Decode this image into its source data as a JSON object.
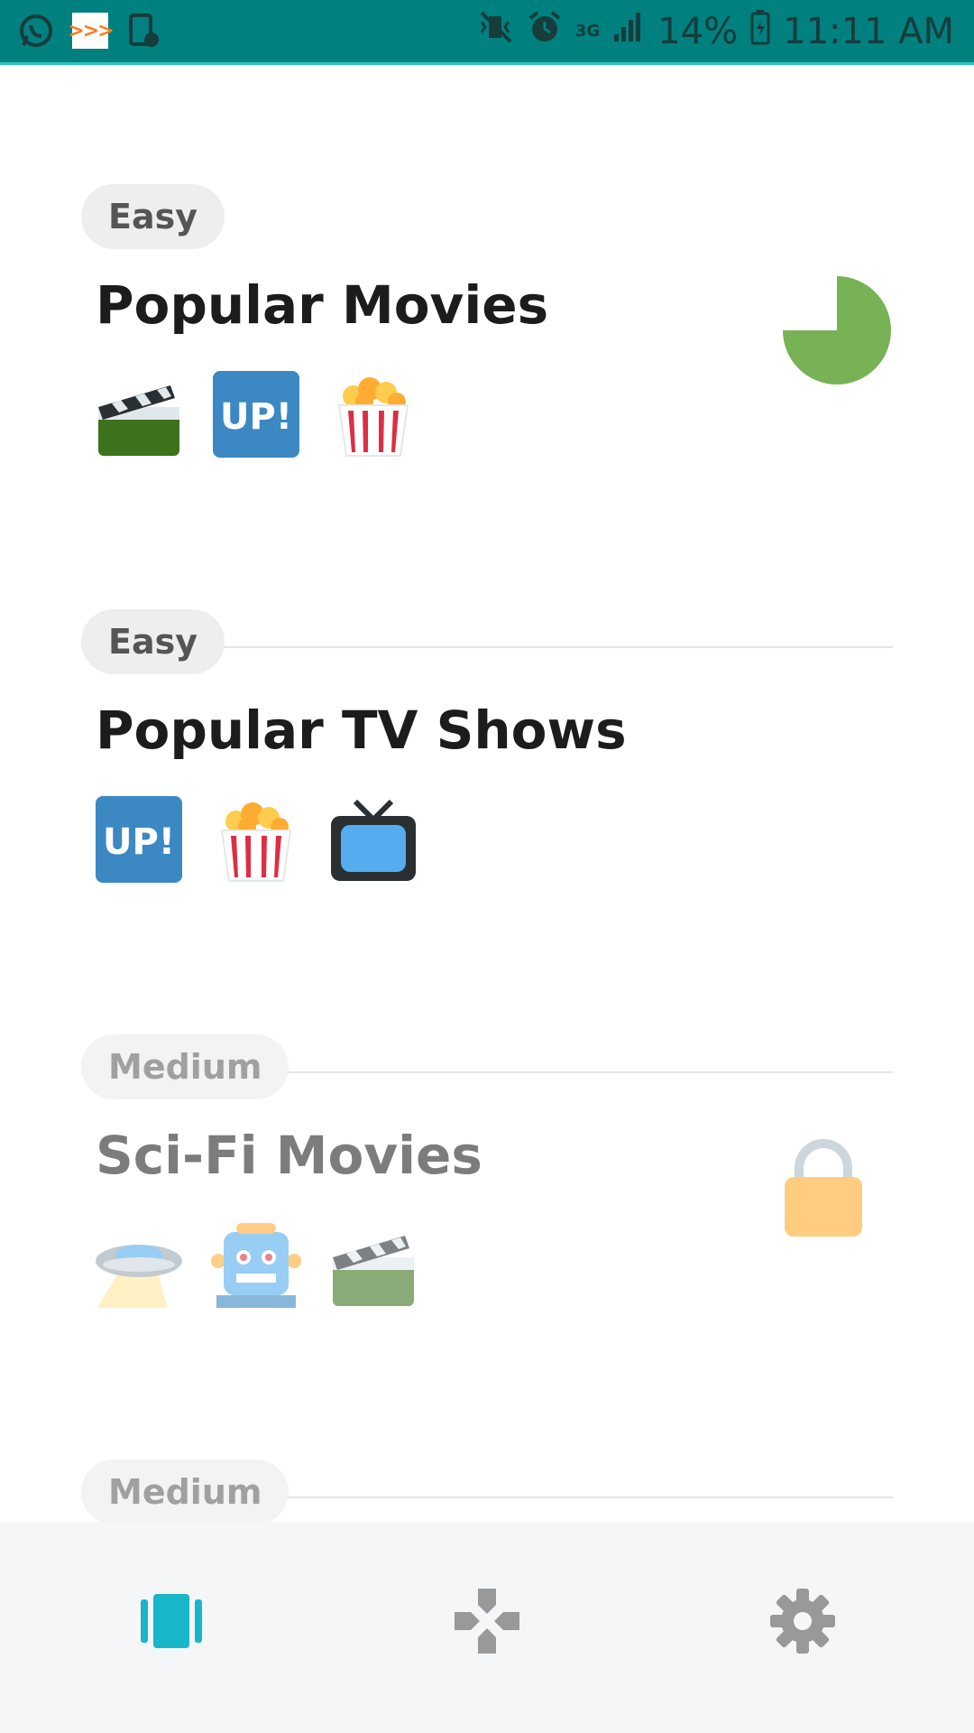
{
  "status_bar": {
    "net_type": "3G",
    "battery": "14%",
    "time": "11:11 AM"
  },
  "categories": [
    {
      "difficulty": "Easy",
      "title": "Popular Movies",
      "emojis": [
        "clapper-board-icon",
        "up-button-icon",
        "popcorn-icon"
      ],
      "progress": 0.75,
      "locked": false
    },
    {
      "difficulty": "Easy",
      "title": "Popular TV Shows",
      "emojis": [
        "up-button-icon",
        "popcorn-icon",
        "television-icon"
      ],
      "locked": false
    },
    {
      "difficulty": "Medium",
      "title": "Sci-Fi Movies",
      "emojis": [
        "flying-saucer-icon",
        "robot-icon",
        "clapper-board-icon"
      ],
      "locked": true
    },
    {
      "difficulty": "Medium"
    }
  ],
  "colors": {
    "status_bar": "#00807f",
    "progress": "#77b255",
    "lock": "#ffcc80",
    "nav_active": "#17b6c9",
    "nav_inactive": "#999999"
  },
  "nav": {
    "items": [
      "cards-icon",
      "gamepad-icon",
      "gear-icon"
    ],
    "active": "cards-icon"
  }
}
